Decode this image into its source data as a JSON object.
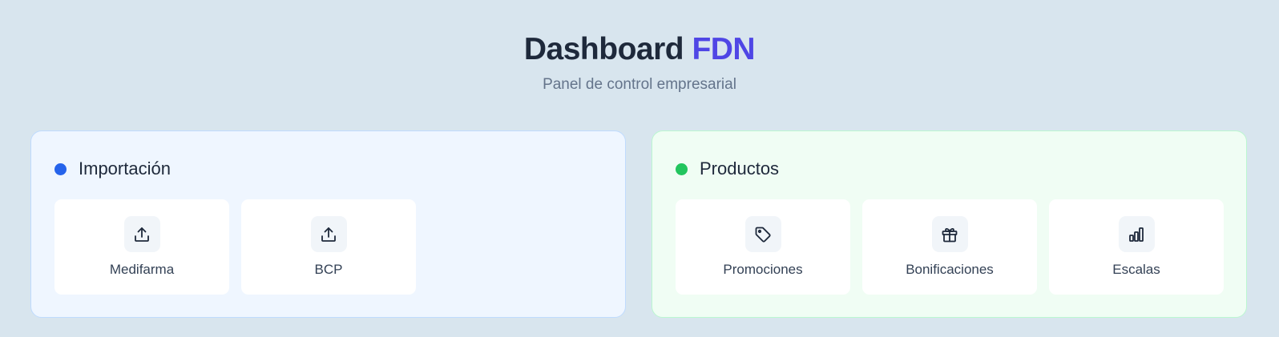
{
  "header": {
    "title": "Dashboard",
    "title_accent": "FDN",
    "subtitle": "Panel de control empresarial"
  },
  "sections": {
    "import": {
      "title": "Importación",
      "dot_color": "#2563eb",
      "cards": [
        {
          "label": "Medifarma",
          "icon": "upload-icon"
        },
        {
          "label": "BCP",
          "icon": "upload-icon"
        }
      ]
    },
    "products": {
      "title": "Productos",
      "dot_color": "#22c55e",
      "cards": [
        {
          "label": "Promociones",
          "icon": "tag-icon"
        },
        {
          "label": "Bonificaciones",
          "icon": "gift-icon"
        },
        {
          "label": "Escalas",
          "icon": "bar-chart-icon"
        }
      ]
    }
  },
  "colors": {
    "background": "#d8e5ee",
    "accent": "#4f46e5",
    "import_panel_bg": "#eff6ff",
    "products_panel_bg": "#f0fdf4"
  }
}
